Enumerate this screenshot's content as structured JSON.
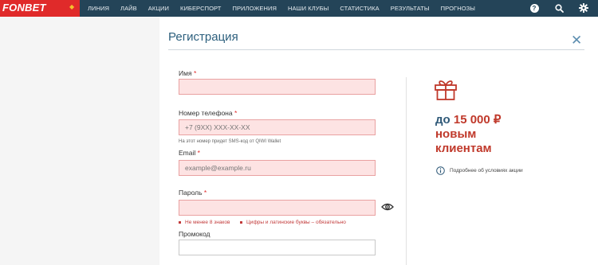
{
  "header": {
    "logo": "FONBET",
    "nav": [
      "ЛИНИЯ",
      "ЛАЙВ",
      "АКЦИИ",
      "КИБЕРСПОРТ",
      "ПРИЛОЖЕНИЯ",
      "НАШИ КЛУБЫ",
      "СТАТИСТИКА",
      "РЕЗУЛЬТАТЫ",
      "ПРОГНОЗЫ"
    ],
    "help_icon": "help-icon",
    "search_icon": "search-icon",
    "settings_icon": "gear-icon"
  },
  "form": {
    "title": "Регистрация",
    "name_label": "Имя",
    "name_value": "",
    "phone_label": "Номер телефона",
    "phone_placeholder": "+7 (9XX) XXX-XX-XX",
    "phone_hint": "На этот номер придет SMS-код от QIWI Wallet",
    "email_label": "Email",
    "email_placeholder": "example@example.ru",
    "password_label": "Пароль",
    "password_rule_1": "Не менее 8 знаков",
    "password_rule_2": "Цифры и латинские буквы – обязательно",
    "promocode_label": "Промокод",
    "required_mark": "*"
  },
  "promo": {
    "prefix": "до",
    "amount": "15 000 ₽",
    "line2": "новым",
    "line3": "клиентам",
    "info_link": "Подробнее об условиях акции"
  },
  "colors": {
    "header_bg": "#244458",
    "logo_bg": "#e02a2a",
    "accent_red": "#c0392b",
    "title_blue": "#2c5f7d"
  }
}
